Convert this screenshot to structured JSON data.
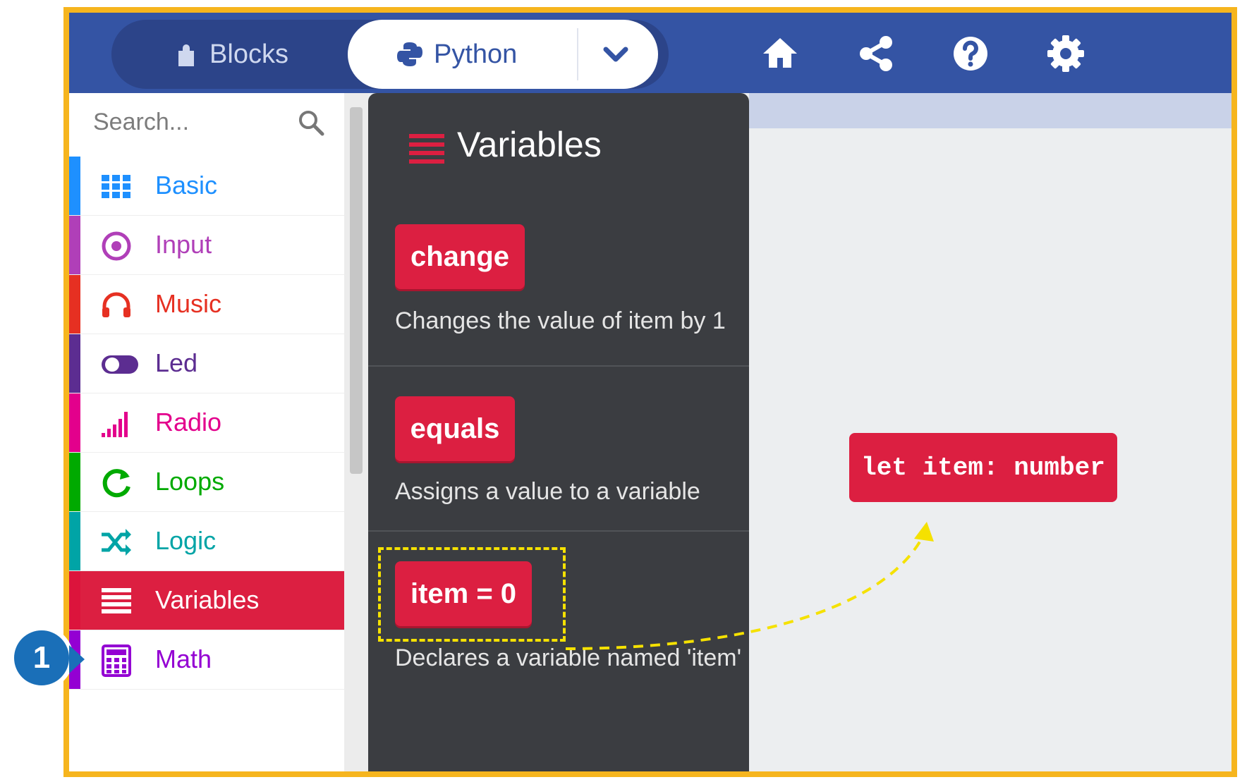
{
  "topbar": {
    "blocks_label": "Blocks",
    "python_label": "Python",
    "icons": [
      "home-icon",
      "share-icon",
      "help-icon",
      "settings-icon"
    ]
  },
  "sidebar": {
    "search_placeholder": "Search...",
    "categories": [
      {
        "label": "Basic",
        "icon": "grid-icon",
        "color": "#1e90ff"
      },
      {
        "label": "Input",
        "icon": "target-icon",
        "color": "#b03fb8"
      },
      {
        "label": "Music",
        "icon": "headphones-icon",
        "color": "#e63022"
      },
      {
        "label": "Led",
        "icon": "toggle-icon",
        "color": "#5c2d91"
      },
      {
        "label": "Radio",
        "icon": "signal-icon",
        "color": "#e3008c"
      },
      {
        "label": "Loops",
        "icon": "refresh-icon",
        "color": "#00aa00"
      },
      {
        "label": "Logic",
        "icon": "shuffle-icon",
        "color": "#00a4a6"
      },
      {
        "label": "Variables",
        "icon": "list-icon",
        "color": "#dc143c",
        "selected": true
      },
      {
        "label": "Math",
        "icon": "calculator-icon",
        "color": "#9400d3"
      }
    ]
  },
  "flyout": {
    "title": "Variables",
    "items": [
      {
        "block": "change",
        "description": "Changes the value of item by 1"
      },
      {
        "block": "equals",
        "description": "Assigns a value to a variable"
      },
      {
        "block": "item = 0",
        "description": "Declares a variable named 'item'"
      }
    ]
  },
  "workspace": {
    "block_code": "let item: number"
  },
  "annotation": {
    "step_number": "1"
  },
  "colors": {
    "topbar": "#3454a4",
    "accent_red": "#dc1f41",
    "flyout_bg": "#3b3d41",
    "frame_border": "#f6b51e",
    "highlight_dash": "#f5e100"
  }
}
